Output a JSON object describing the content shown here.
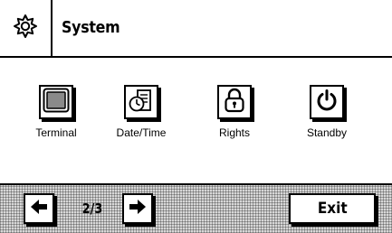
{
  "header": {
    "icon": "settings-gear-icon",
    "title": "System"
  },
  "apps": [
    {
      "label": "Terminal",
      "icon": "terminal-icon"
    },
    {
      "label": "Date/Time",
      "icon": "date-time-icon"
    },
    {
      "label": "Rights",
      "icon": "padlock-icon"
    },
    {
      "label": "Standby",
      "icon": "power-icon"
    }
  ],
  "footer": {
    "prev_icon": "arrow-left-icon",
    "page_indicator": "2/3",
    "next_icon": "arrow-right-icon",
    "exit_label": "Exit"
  }
}
